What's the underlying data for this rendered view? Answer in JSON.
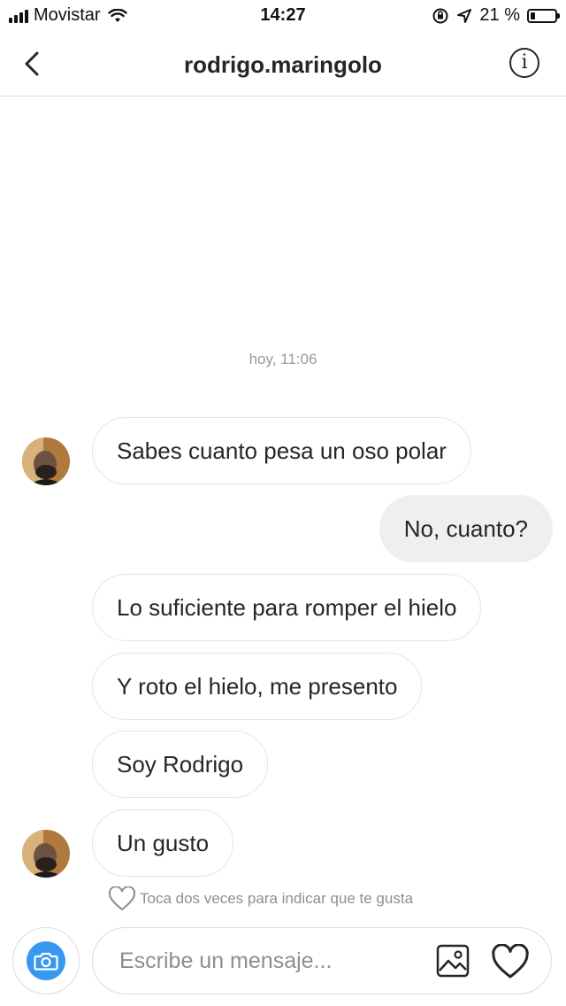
{
  "status_bar": {
    "carrier": "Movistar",
    "time": "14:27",
    "battery_percent_label": "21 %",
    "battery_level": 0.21,
    "signal_bars": 4,
    "icons": [
      "signal-icon",
      "wifi-icon",
      "orientation-lock-icon",
      "location-arrow-icon",
      "battery-icon"
    ]
  },
  "header": {
    "title": "rodrigo.maringolo",
    "back_icon": "chevron-left-icon",
    "info_label": "i"
  },
  "thread": {
    "timestamp": "hoy, 11:06",
    "messages": [
      {
        "direction": "incoming",
        "text": "Sabes cuanto pesa un oso polar",
        "avatar": true
      },
      {
        "direction": "outgoing",
        "text": "No, cuanto?"
      },
      {
        "direction": "incoming",
        "text": "Lo suficiente para romper el hielo"
      },
      {
        "direction": "incoming",
        "text": "Y roto el hielo, me presento"
      },
      {
        "direction": "incoming",
        "text": "Soy Rodrigo"
      },
      {
        "direction": "incoming",
        "text": "Un gusto",
        "avatar": true
      }
    ],
    "like_hint": "Toca dos veces para indicar que te gusta"
  },
  "composer": {
    "placeholder": "Escribe un mensaje...",
    "camera_icon": "camera-icon",
    "gallery_icon": "gallery-icon",
    "like_icon": "heart-icon"
  },
  "colors": {
    "accent": "#3897f0",
    "outgoing_bubble": "#efefef",
    "border": "#dbdbdb",
    "muted_text": "#8e8e8e"
  }
}
